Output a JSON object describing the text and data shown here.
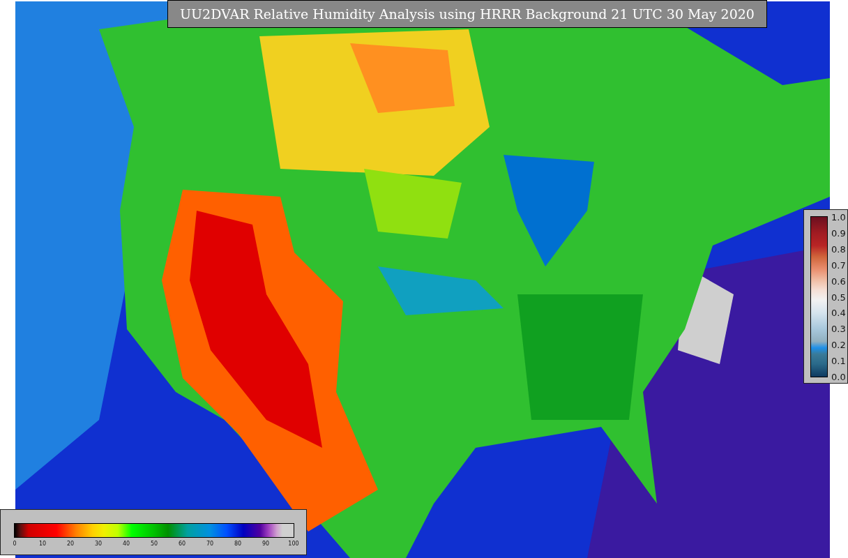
{
  "title": "UU2DVAR Relative Humidity Analysis using HRRR Background 21 UTC 30 May 2020",
  "humidity_colorbar": {
    "ticks": [
      "0",
      "10",
      "20",
      "30",
      "40",
      "50",
      "60",
      "70",
      "80",
      "90",
      "100"
    ]
  },
  "ratio_colorbar": {
    "ticks": [
      "1.0",
      "0.9",
      "0.8",
      "0.7",
      "0.6",
      "0.5",
      "0.4",
      "0.3",
      "0.2",
      "0.1",
      "0.0"
    ]
  }
}
